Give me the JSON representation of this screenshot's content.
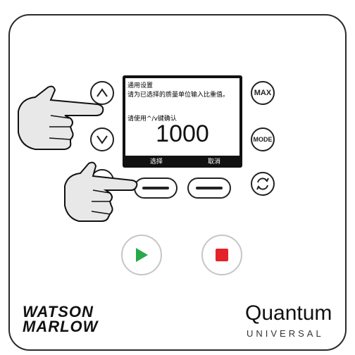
{
  "screen": {
    "title": "通用设置",
    "line1": "请为已选择的质量单位输入比重值。",
    "hint": "请使用^/v键确认",
    "value": "1000",
    "softkey_left": "选择",
    "softkey_right": "取消"
  },
  "buttons": {
    "max_label": "MAX",
    "mode_label": "MODE"
  },
  "brand": {
    "left_line1": "WATSON",
    "left_line2": "MARLOW",
    "right_name": "Quantum",
    "right_sub": "UNIVERSAL"
  },
  "colors": {
    "start": "#2aa84a",
    "stop": "#e4222b",
    "screen_frame": "#111111"
  },
  "icons": [
    "up-arrow-icon",
    "down-arrow-icon",
    "cycle-icon",
    "play-icon",
    "stop-icon",
    "hand-pointer-icon"
  ]
}
